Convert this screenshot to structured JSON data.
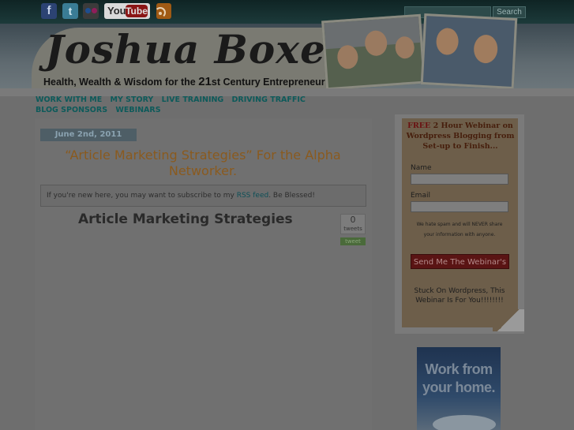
{
  "social": {
    "facebook_glyph": "f",
    "twitter_glyph": "t",
    "youtube_you": "You",
    "youtube_tube": "Tube"
  },
  "search": {
    "placeholder": "",
    "button_label": "Search"
  },
  "header": {
    "logo": "Joshua Boxer",
    "tagline": {
      "part1": "Health, Wealth & Wisdom for the ",
      "big_number": "21",
      "suffix": "st Century Entrepreneur"
    }
  },
  "nav": {
    "items": [
      "WORK WITH ME",
      "MY STORY",
      "LIVE TRAINING",
      "DRIVING TRAFFIC",
      "BLOG SPONSORS",
      "WEBINARS"
    ]
  },
  "post": {
    "date": "June 2nd, 2011",
    "title": "“Article Marketing Strategies” For the Alpha Networker.",
    "rss_notice": {
      "before": "If you're new here, you may want to subscribe to my ",
      "link": "RSS feed",
      "after": ". Be Blessed!"
    },
    "heading": "Article Marketing Strategies",
    "tweets": {
      "count": "0",
      "label": "tweets",
      "button": "tweet"
    }
  },
  "optin": {
    "free": "FREE",
    "headline": " 2 Hour Webinar on Wordpress Blogging from Set-up to Finish...",
    "name_label": "Name",
    "email_label": "Email",
    "privacy": "We hate spam and will NEVER share your information with anyone.",
    "submit_label": "Send Me The Webinar's",
    "footer": "Stuck On Wordpress, This Webinar Is For You!!!!!!!!"
  },
  "ad": {
    "text": "Work from your home."
  }
}
